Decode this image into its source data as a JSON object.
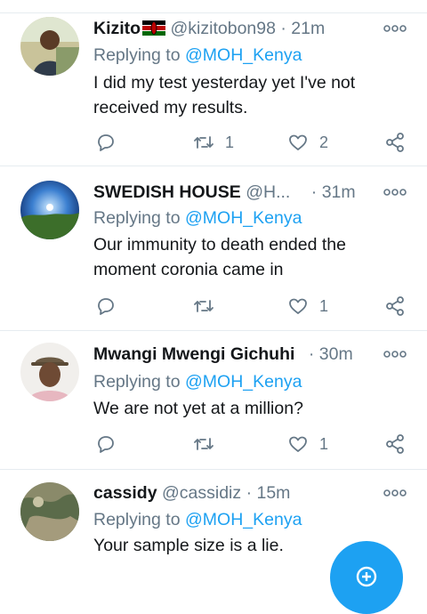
{
  "tweets": [
    {
      "name": "Kizito",
      "handle": "@kizitobon98",
      "separator": "·",
      "time": "21m",
      "replying_label": "Replying to",
      "replying_to": "@MOH_Kenya",
      "text": "I did my test yesterday yet I've not received my results.",
      "retweets": "1",
      "likes": "2"
    },
    {
      "name": "SWEDISH HOUSE",
      "handle": "@H...",
      "separator": "·",
      "time": "31m",
      "replying_label": "Replying to",
      "replying_to": "@MOH_Kenya",
      "text": "Our immunity to death ended the moment coronia came in",
      "retweets": "",
      "likes": "1"
    },
    {
      "name": "Mwangi Mwengi Gichuhi",
      "handle": "",
      "separator": "·",
      "time": "30m",
      "replying_label": "Replying to",
      "replying_to": "@MOH_Kenya",
      "text": "We are not yet at a million?",
      "retweets": "",
      "likes": "1"
    },
    {
      "name": "cassidy",
      "handle": "@cassidiz",
      "separator": "·",
      "time": "15m",
      "replying_label": "Replying to",
      "replying_to": "@MOH_Kenya",
      "text": "Your sample size is a lie."
    }
  ],
  "icons": {
    "reply": "reply-icon",
    "retweet": "retweet-icon",
    "like": "heart-icon",
    "share": "share-icon",
    "more": "more-options-icon",
    "compose": "compose-icon"
  },
  "colors": {
    "accent": "#1da1f2",
    "muted": "#657786",
    "text": "#14171a",
    "divider": "#e6ecf0"
  }
}
